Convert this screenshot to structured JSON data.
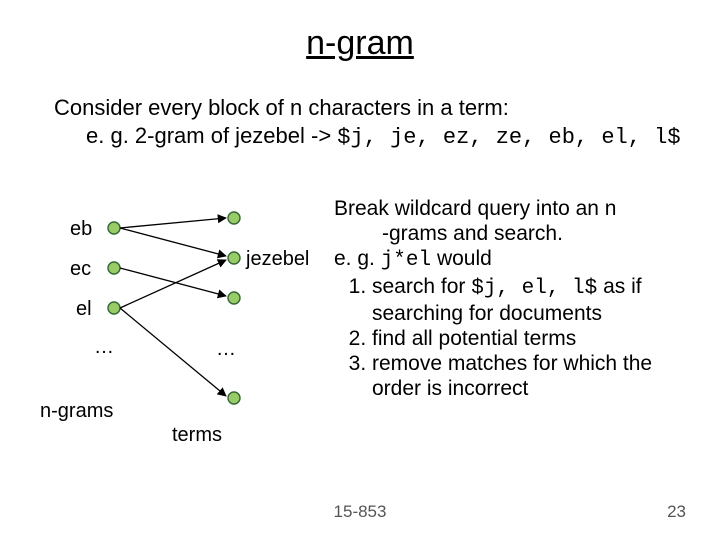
{
  "title": "n-gram",
  "intro": {
    "line1": "Consider every block of n characters in a term:",
    "line2_prefix": "e. g. 2-gram of jezebel -> ",
    "line2_mono": "$j, je, ez, ze, eb, el, l$"
  },
  "diagram": {
    "left_nodes": [
      "eb",
      "ec",
      "el"
    ],
    "left_ellipsis": "…",
    "left_axis": "n-grams",
    "right_node": "jezebel",
    "right_ellipsis": "…",
    "right_axis": "terms"
  },
  "bullets": {
    "intro1": "Break wildcard query into an n",
    "intro1b": "-grams and search.",
    "eg_prefix": "e. g. ",
    "eg_mono": "j*el",
    "eg_suffix": " would",
    "step1_prefix": "search for ",
    "step1_mono": "$j, el, l$",
    "step1_suffix": " as if searching for documents",
    "step2": "find all potential terms",
    "step3": "remove matches for which the order is incorrect"
  },
  "footer": {
    "course": "15-853",
    "page": "23"
  }
}
